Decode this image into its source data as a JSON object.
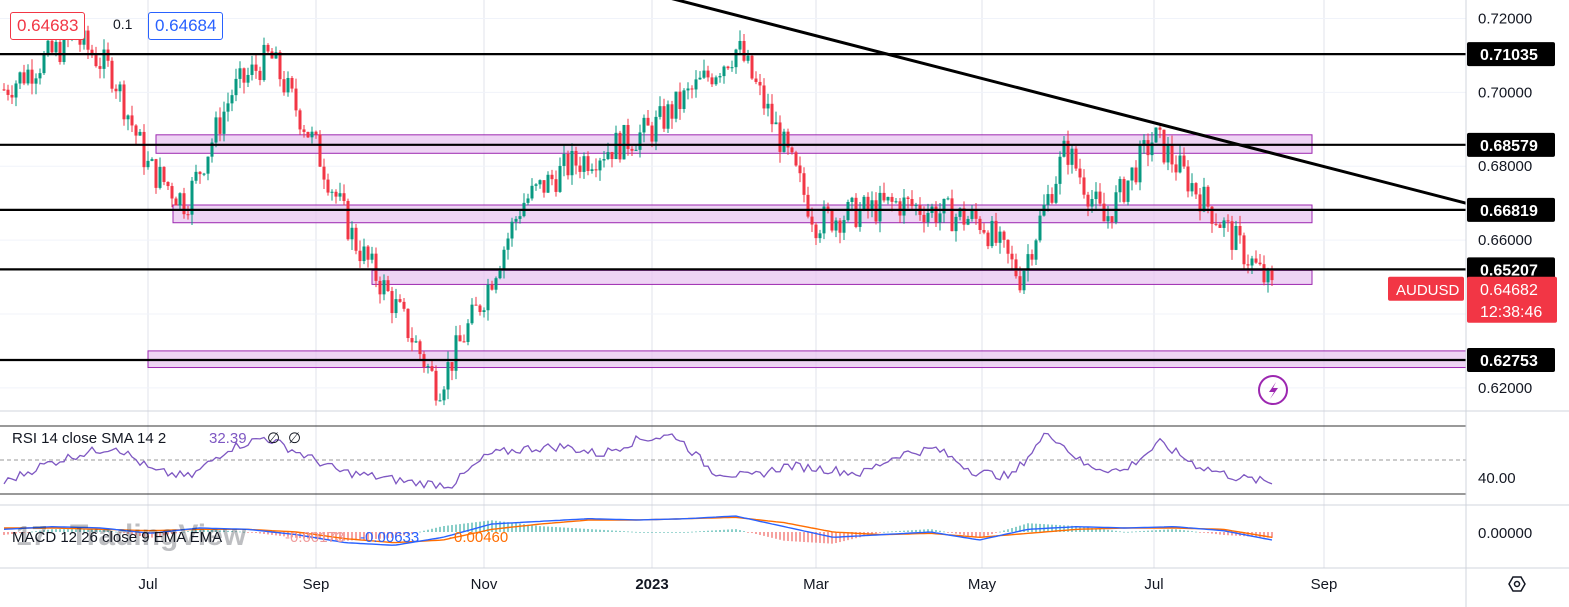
{
  "toolbar": {
    "bid": "0.64683",
    "spread": "0.1",
    "ask": "0.64684"
  },
  "symbol": "AUDUSD",
  "last_price": "0.64682",
  "countdown": "12:38:46",
  "watermark": "TradingView",
  "colors": {
    "up": "#089981",
    "down": "#f23645",
    "zone_fill": "#e8c6f0",
    "zone_stroke": "#9c27b0",
    "rsi_line": "#7e57c2",
    "macd_line": "#2962ff",
    "signal_line": "#ff6d00"
  },
  "chart_data": [
    {
      "type": "candlestick",
      "series_name": "AUDUSD",
      "x_ticks": [
        "Jul",
        "Sep",
        "Nov",
        "2023",
        "Mar",
        "May",
        "Jul",
        "Sep"
      ],
      "y_ticks": [
        "0.62000",
        "0.64000",
        "0.66000",
        "0.68000",
        "0.70000",
        "0.72000"
      ],
      "ylim": [
        0.614,
        0.725
      ],
      "price_labels": [
        "0.71035",
        "0.68579",
        "0.66819",
        "0.65207",
        "0.62753"
      ],
      "horizontal_levels": [
        0.71035,
        0.68579,
        0.66819,
        0.65207,
        0.62753
      ],
      "zones": [
        {
          "from": "Jul",
          "to": "Aug 2023",
          "low": 0.6835,
          "high": 0.6885
        },
        {
          "from": "Jul",
          "to": "Aug 2023",
          "low": 0.6647,
          "high": 0.6695
        },
        {
          "from": "Sep",
          "to": "Aug 2023",
          "low": 0.648,
          "high": 0.6518
        },
        {
          "from": "Jul",
          "to": "Sep 2023",
          "low": 0.6255,
          "high": 0.63
        }
      ],
      "trendline": {
        "start": [
          "May 2022",
          0.729
        ],
        "end": [
          "Sep 2023",
          0.67
        ]
      },
      "path": [
        [
          "May 2022",
          0.7
        ],
        [
          "Jun 2022",
          0.715
        ],
        [
          "Jun 2022",
          0.705
        ],
        [
          "Jul 2022",
          0.68
        ],
        [
          "Jul 2022",
          0.67
        ],
        [
          "Aug 2022",
          0.7
        ],
        [
          "Aug 2022",
          0.71
        ],
        [
          "Sep 2022",
          0.685
        ],
        [
          "Sep 2022",
          0.66
        ],
        [
          "Oct 2022",
          0.64
        ],
        [
          "Oct 2022",
          0.62
        ],
        [
          "Nov 2022",
          0.645
        ],
        [
          "Nov 2022",
          0.67
        ],
        [
          "Dec 2022",
          0.68
        ],
        [
          "Jan 2023",
          0.69
        ],
        [
          "Feb 2023",
          0.712
        ],
        [
          "Feb 2023",
          0.69
        ],
        [
          "Mar 2023",
          0.665
        ],
        [
          "Apr 2023",
          0.67
        ],
        [
          "May 2023",
          0.665
        ],
        [
          "May 2023",
          0.65
        ],
        [
          "Jun 2023",
          0.685
        ],
        [
          "Jun 2023",
          0.665
        ],
        [
          "Jul 2023",
          0.688
        ],
        [
          "Jul 2023",
          0.675
        ],
        [
          "Aug 2023",
          0.6468
        ]
      ]
    },
    {
      "type": "line",
      "indicator": "RSI",
      "label": "RSI 14 close SMA 14 2",
      "value": "32.39",
      "extra": [
        "∅",
        "∅"
      ],
      "y_ticks": [
        "40.00"
      ],
      "series": [
        {
          "name": "RSI",
          "values": [
            30,
            45,
            55,
            62,
            40,
            35,
            60,
            70,
            55,
            40,
            35,
            30,
            28,
            55,
            60,
            62,
            55,
            68,
            72,
            40,
            35,
            45,
            42,
            38,
            55,
            60,
            40,
            35,
            75,
            45,
            40,
            65,
            45,
            35,
            30
          ]
        }
      ]
    },
    {
      "type": "line",
      "indicator": "MACD",
      "label": "MACD 12 26 close 9 EMA EMA",
      "histogram_value": "-0.00173",
      "macd_value": "-0.00633",
      "signal_value": "-0.00460",
      "y_ticks": [
        "0.00000"
      ],
      "series": [
        {
          "name": "MACD",
          "values": [
            0.002,
            0.004,
            0.003,
            -0.001,
            0.003,
            0.002,
            -0.002,
            -0.008,
            -0.01,
            -0.004,
            0.006,
            0.008,
            0.01,
            0.009,
            0.01,
            0.012,
            0.004,
            -0.004,
            -0.002,
            0.0,
            -0.006,
            0.002,
            0.004,
            0.003,
            0.004,
            0.001,
            -0.006
          ]
        },
        {
          "name": "Signal",
          "values": [
            0.003,
            0.003,
            0.002,
            0.001,
            0.002,
            0.002,
            0.0,
            -0.005,
            -0.008,
            -0.006,
            0.002,
            0.006,
            0.009,
            0.009,
            0.01,
            0.011,
            0.007,
            0.0,
            -0.002,
            -0.001,
            -0.004,
            -0.001,
            0.002,
            0.003,
            0.003,
            0.002,
            -0.004
          ]
        }
      ]
    }
  ]
}
